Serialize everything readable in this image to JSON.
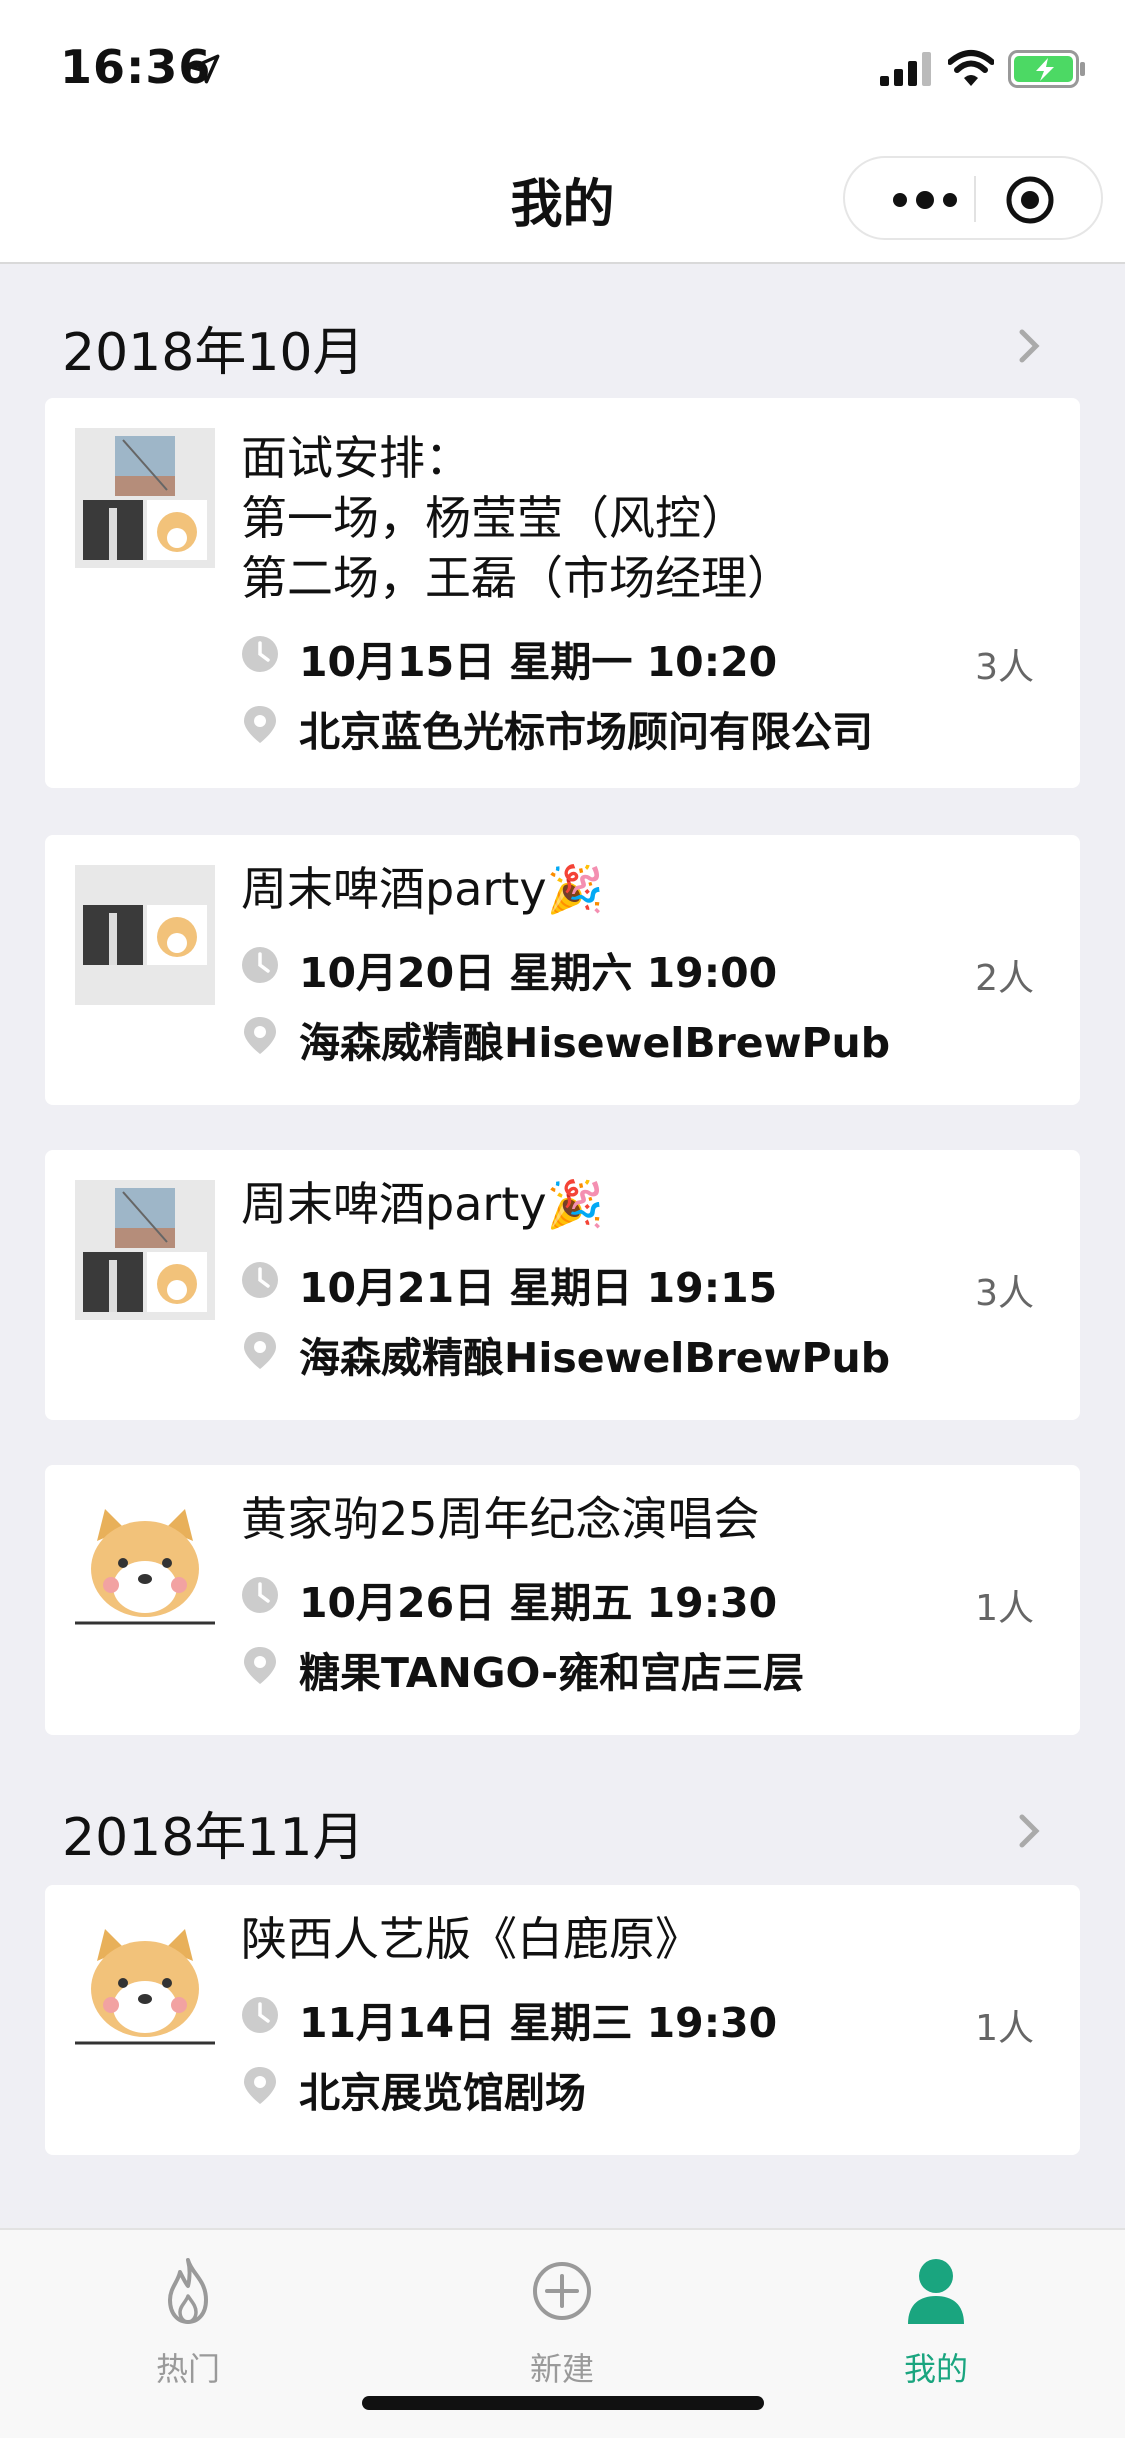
{
  "status_bar": {
    "time": "16:36"
  },
  "nav": {
    "title": "我的"
  },
  "months": [
    {
      "label": "2018年10月",
      "events": [
        {
          "title": "面试安排：\n第一场，杨莹莹（风控）\n第二场，王磊（市场经理）",
          "datetime": "10月15日 星期一 10:20",
          "location": "北京蓝色光标市场顾问有限公司",
          "count": "3人"
        },
        {
          "title": "周末啤酒party🎉",
          "datetime": "10月20日 星期六 19:00",
          "location": "海森威精酿HisewelBrewPub",
          "count": "2人"
        },
        {
          "title": "周末啤酒party🎉",
          "datetime": "10月21日 星期日 19:15",
          "location": "海森威精酿HisewelBrewPub",
          "count": "3人"
        },
        {
          "title": "黄家驹25周年纪念演唱会",
          "datetime": "10月26日 星期五 19:30",
          "location": "糖果TANGO-雍和宫店三层",
          "count": "1人"
        }
      ]
    },
    {
      "label": "2018年11月",
      "events": [
        {
          "title": "陕西人艺版《白鹿原》",
          "datetime": "11月14日 星期三 19:30",
          "location": "北京展览馆剧场",
          "count": "1人"
        }
      ]
    }
  ],
  "tabs": [
    {
      "label": "热门",
      "icon": "flame-icon"
    },
    {
      "label": "新建",
      "icon": "plus-circle-icon"
    },
    {
      "label": "我的",
      "icon": "person-icon",
      "active": true
    }
  ],
  "colors": {
    "accent": "#1aa57f",
    "background": "#efeff4",
    "card": "#ffffff"
  }
}
